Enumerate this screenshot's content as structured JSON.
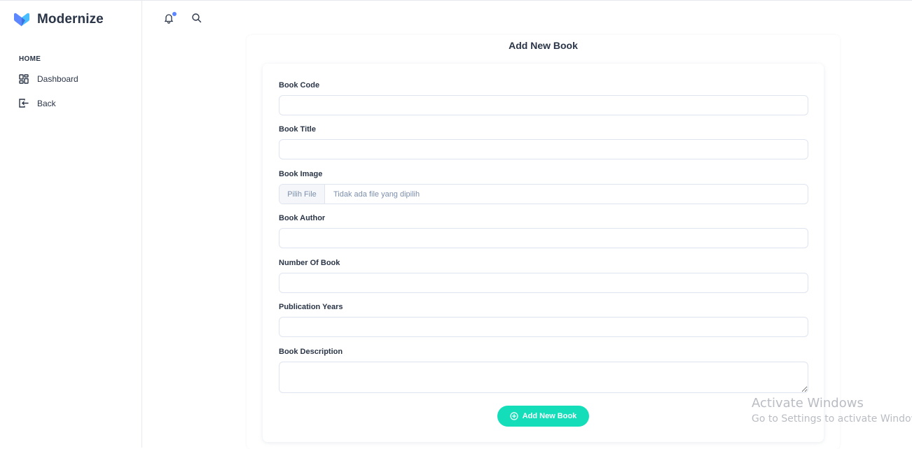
{
  "brand": {
    "name": "Modernize",
    "colors": {
      "primary": "#5d87ff",
      "secondary": "#49beff",
      "success": "#13deb9"
    }
  },
  "sidebar": {
    "caption": "HOME",
    "items": [
      {
        "label": "Dashboard",
        "icon": "dashboard-grid-icon"
      },
      {
        "label": "Back",
        "icon": "logout-icon"
      }
    ]
  },
  "header": {
    "icons": [
      "bell-icon",
      "search-icon"
    ]
  },
  "form": {
    "title": "Add New Book",
    "fields": {
      "book_code": {
        "label": "Book Code",
        "value": ""
      },
      "book_title": {
        "label": "Book Title",
        "value": ""
      },
      "book_image": {
        "label": "Book Image",
        "button": "Pilih File",
        "status": "Tidak ada file yang dipilih"
      },
      "book_author": {
        "label": "Book Author",
        "value": ""
      },
      "number_of_book": {
        "label": "Number Of Book",
        "value": ""
      },
      "publication_years": {
        "label": "Publication Years",
        "value": ""
      },
      "book_description": {
        "label": "Book Description",
        "value": ""
      }
    },
    "submit_label": "Add New Book"
  },
  "watermark": {
    "line1": "Activate Windows",
    "line2": "Go to Settings to activate Windows."
  }
}
